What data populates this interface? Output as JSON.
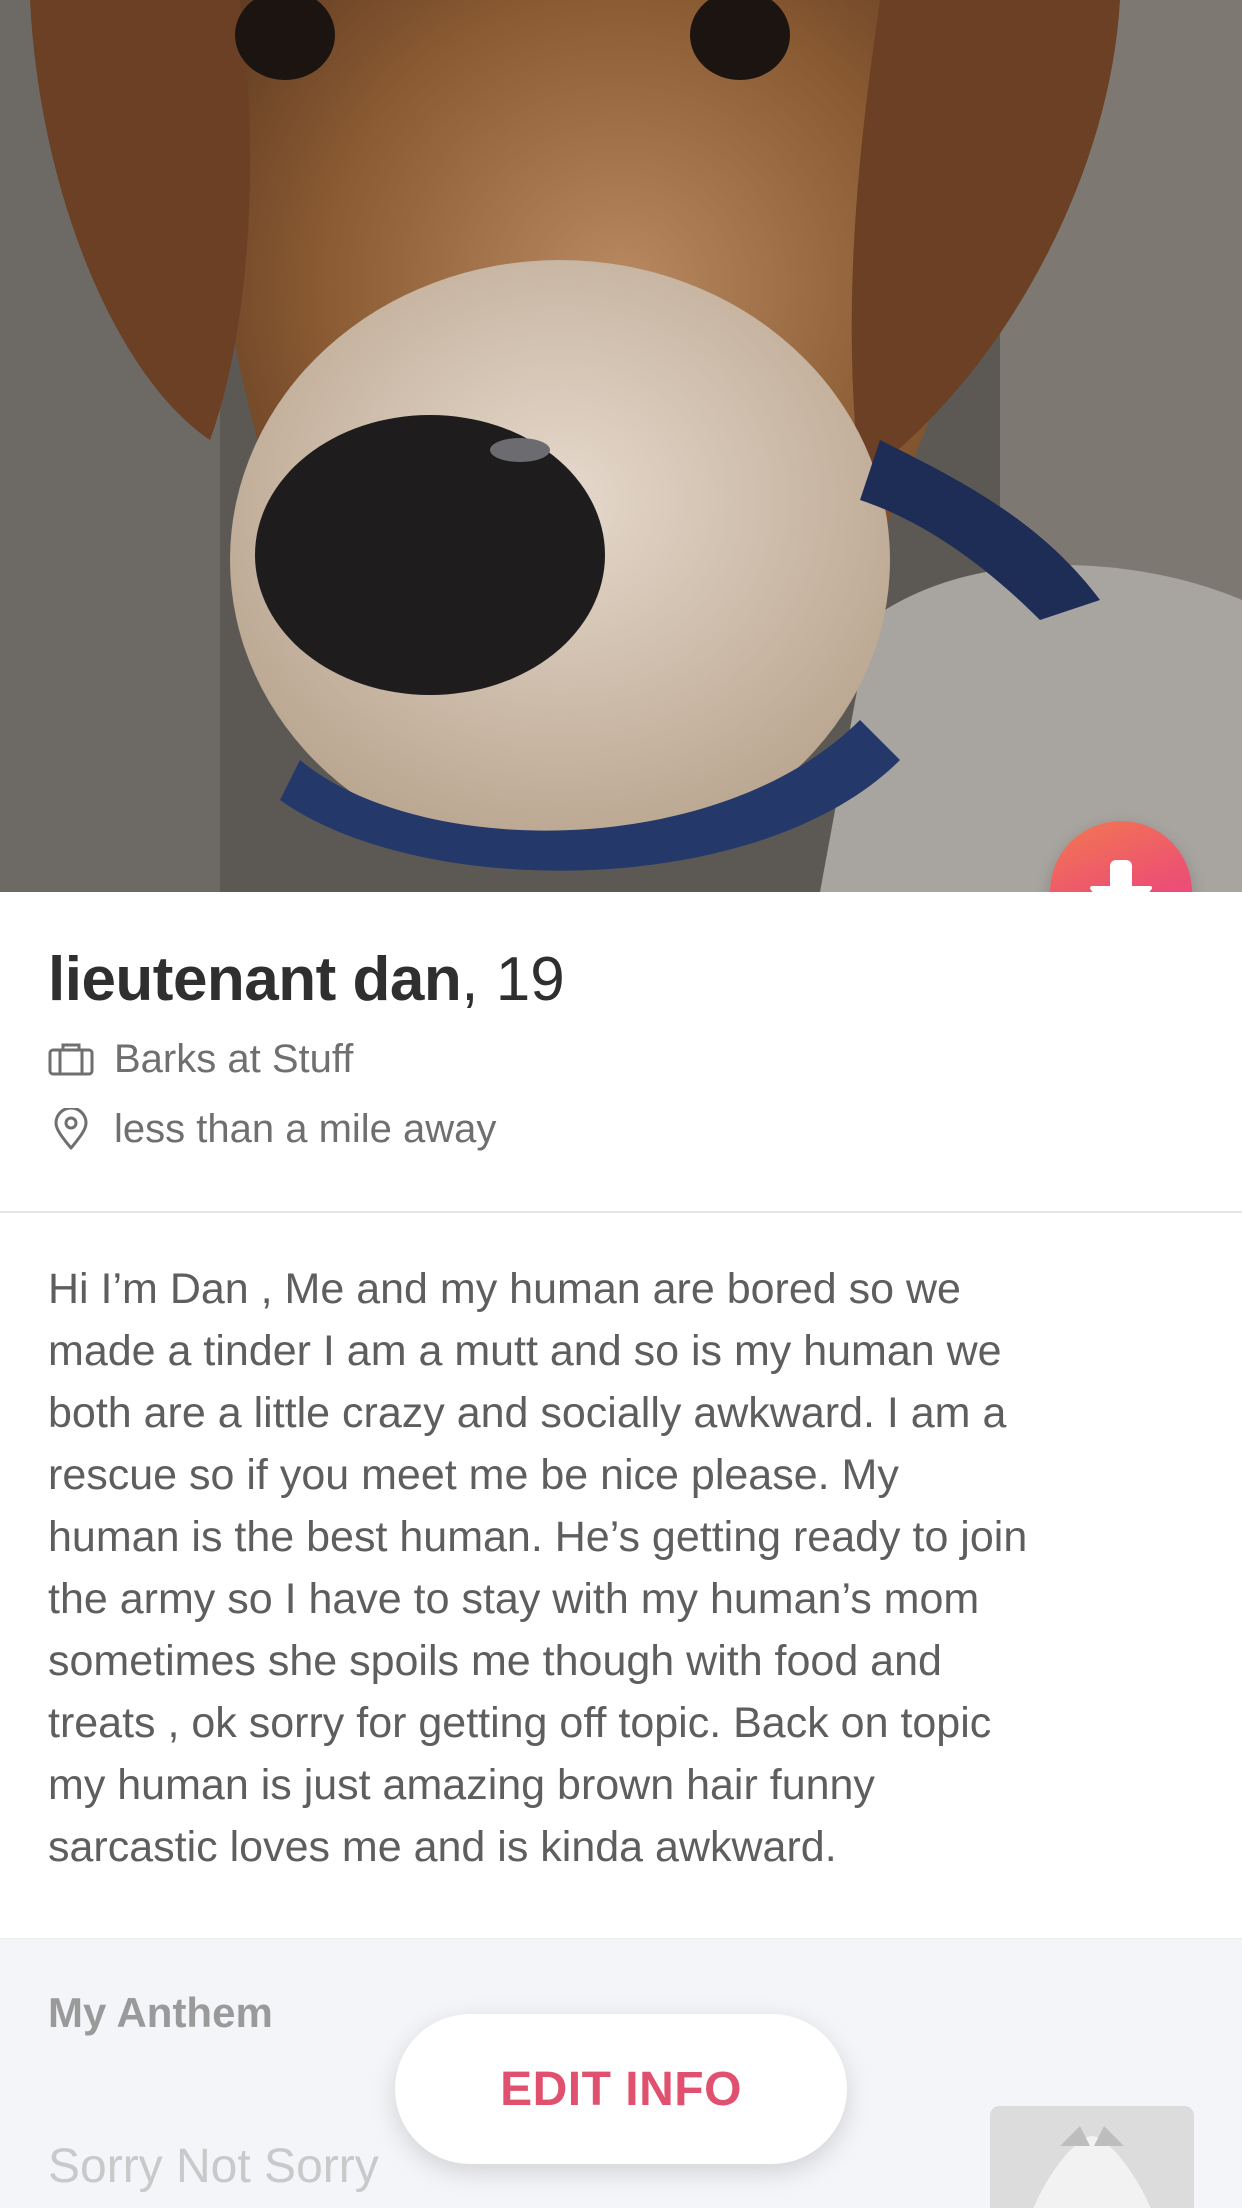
{
  "profile": {
    "name": "lieutenant dan",
    "separator": ",",
    "age": "19",
    "job": "Barks at Stuff",
    "distance": "less than a mile away",
    "bio": "Hi I’m Dan , Me and my human  are bored so we\nmade a tinder I am a mutt and so is my human we\nboth are a little crazy and socially awkward. I am a\nrescue so if you meet me be nice please. My\nhuman is the best human. He’s getting ready to join\nthe army so I have to stay with my human’s mom\nsometimes she spoils me though with food and\ntreats , ok sorry for getting off topic. Back on topic\nmy human is just amazing brown hair funny\nsarcastic loves me and is kinda awkward."
  },
  "anthem": {
    "title": "My Anthem",
    "song": "Sorry Not Sorry"
  },
  "actions": {
    "edit_label": "EDIT INFO"
  },
  "icons": {
    "collapse": "arrow-down-icon",
    "job": "briefcase-icon",
    "distance": "location-pin-icon"
  },
  "colors": {
    "accent": "#e0506f",
    "gradient_start": "#f3784f",
    "gradient_end": "#e84585"
  }
}
